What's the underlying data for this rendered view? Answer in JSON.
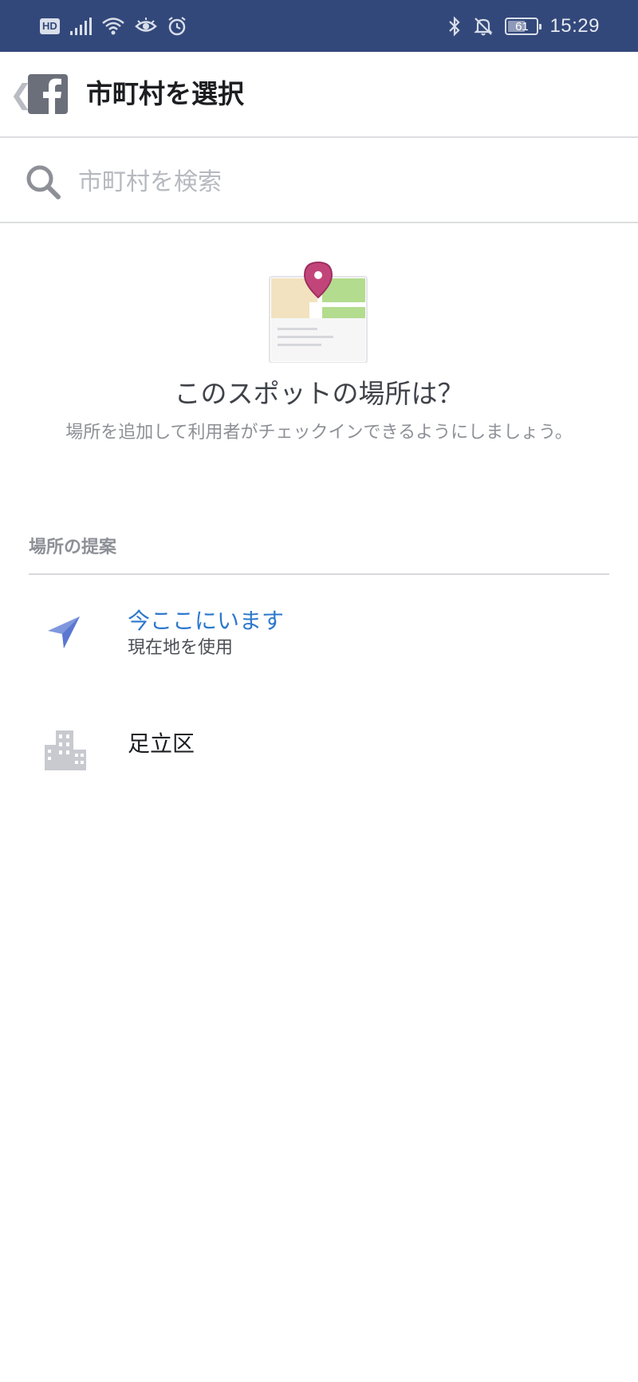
{
  "status_bar": {
    "hd_label": "HD",
    "battery_level": 61,
    "battery_text": "61",
    "time": "15:29",
    "icons": [
      "signal-icon",
      "wifi-icon",
      "eye-icon",
      "alarm-icon",
      "bluetooth-icon",
      "mute-icon",
      "battery-icon"
    ]
  },
  "header": {
    "back_icon": "chevron-left-icon",
    "logo": "facebook-logo",
    "title": "市町村を選択"
  },
  "search": {
    "icon": "search-icon",
    "placeholder": "市町村を検索",
    "value": ""
  },
  "empty_state": {
    "illustration": "map-pin-illustration",
    "title": "このスポットの場所は？",
    "description": "場所を追加して利用者がチェックインできるようにしましょう。"
  },
  "suggestions": {
    "header": "場所の提案",
    "items": [
      {
        "icon": "location-arrow-icon",
        "title": "今ここにいます",
        "subtitle": "現在地を使用"
      },
      {
        "icon": "city-building-icon",
        "title": "足立区"
      }
    ]
  },
  "colors": {
    "status_bar_bg": "#33487a",
    "accent_blue": "#2d78cc",
    "pin_magenta": "#c2457a",
    "map_green": "#b3dc8f",
    "map_beige": "#f2e2bf"
  }
}
